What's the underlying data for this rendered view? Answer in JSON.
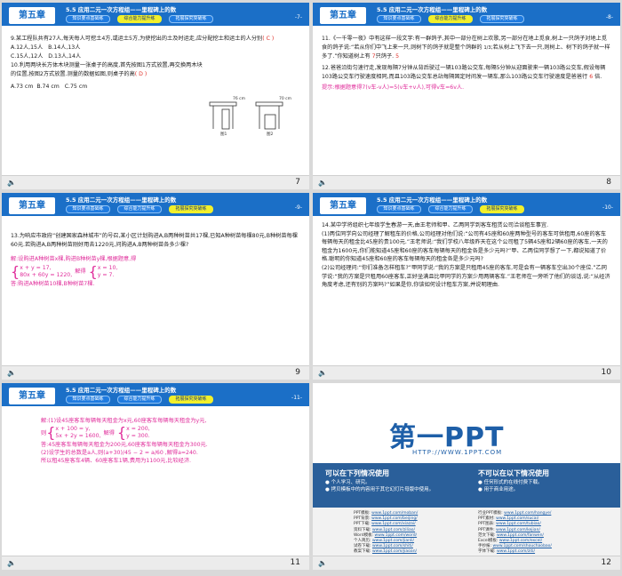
{
  "common": {
    "chapter": "第五章",
    "subtitle": "5.5 应用二元一次方程组——里程碑上的数",
    "tabs": [
      "知识要点基础练",
      "综合能力提升练",
      "拓展探究突破练"
    ]
  },
  "slides": [
    {
      "page_label": "-7-",
      "active_tab": 1,
      "footer_num": "7",
      "q9": "9.某工程队共有27人,每天每人可挖土4方,或运土5方,为使挖出的土及时运走,应分配挖土和运土的人分别",
      "q9_answer": "( C )",
      "q9_options": [
        "A.12人,15人",
        "B.14人,13人",
        "C.15人,12人",
        "D.13人,14人"
      ],
      "q10": "10.利用两块长方体木块测量一张桌子的高度,首先按图1方式放置,再交换两木块的位置,按图2方式放置.测量的数据如图,则桌子的高",
      "q10_answer": "( D )",
      "q10_options": [
        "A.73 cm",
        "B.74 cm",
        "C.75 cm"
      ],
      "fig_labels": [
        "图1",
        "图2",
        "76 cm",
        "70 cm"
      ]
    },
    {
      "page_label": "-8-",
      "active_tab": 1,
      "footer_num": "8",
      "q11": "11.《一千零一夜》中有这样一段文字:有一群鸽子,其中一部分在树上欢歌,另一部分在地上觅食,树上一只鸽子对地上觅食的鸽子说:“若从你们中飞上来一只,则树下的鸽子就是整个鸽群的",
      "q11_b": ";若从树上飞下去一只,则树上、树下的鸽子就一样多了.”你知道树上有",
      "q11_answer": "7",
      "q11_c": "只鸽子.",
      "q11_d": "5",
      "q12": "12.爸爸沿街匀速行走,发现每隔7分钟从背后驶过一辆103路公交车,每隔5分钟从迎面驶来一辆103路公交车,假设每辆103路公交车行驶速度相同,而且103路公交车总站每隔固定时间发一辆车,那么103路公交车行驶速度是爸爸行",
      "q12_answer": "6",
      "q12_b": "倍.",
      "hint": "提示:根据题意得7(v车-v人)=5(v车+v人),可得v车=6v人."
    },
    {
      "page_label": "-9-",
      "active_tab": 2,
      "footer_num": "9",
      "q13": "13.为响应市政府“创建国家森林城市”的号召,某小区计划购进A,B两种树苗共17棵,已知A种树苗每棵80元,B种树苗每棵60元.若购进A,B两种树苗刚好用去1220元,问购进A,B两种树苗各多少棵?",
      "sol_1": "解:设购进A种树苗x棵,购进B种树苗y棵,根据题意,得",
      "sol_eq1": "x + y = 17,",
      "sol_eq2": "80x + 60y = 1220,",
      "sol_solve": "解得",
      "sol_res1": "x = 10,",
      "sol_res2": "y = 7.",
      "sol_2": "答:购进A种树苗10棵,B种树苗7棵."
    },
    {
      "page_label": "-10-",
      "active_tab": 2,
      "footer_num": "10",
      "q14": "14.某中学将组织七年级学生春游一天,由王老师和甲、乙两同学到客车租赁公司洽谈租车事宜.",
      "q14_1": "(1)两位同学向公司经理了解租车的价格,公司经理对他们说:“公司有45座和60座两种型号的客车可供租用,60座的客车每辆每天的租金比45座的贵100元.”王老师说:“我们学校八年级昨天在这个公司租了5辆45座和2辆60座的客车,一天的租金为1600元,你们能知道45座和60座的客车每辆每天的租金各是多少元吗?”甲、乙两位同学想了一下,都说知道了价格.聪明的你知道45座和60座的客车每辆每天的租金各是多少元吗?",
      "q14_2": "(2)公司经理问:“你们准备怎样租车?”甲同学说:“我的方案是只租用45座的客车,可是会有一辆客车空出30个座位.”乙同学说:“我的方案是只租用60座客车,正好坐满且比甲同学的方案少用两辆客车.”王老师在一旁听了他们的谈话,说:“从经济角度考虑,还有别的方案吗?”如果是你,你该如何设计租车方案,并说明理由."
    },
    {
      "page_label": "-11-",
      "active_tab": 2,
      "footer_num": "11",
      "sol_1": "解:(1)设45座客车每辆每天租金为x元,60座客车每辆每天租金为y元,",
      "sol_then": "则",
      "sol_eq1": "x + 100 = y,",
      "sol_eq2": "5x + 2y = 1600,",
      "sol_solve": "解得",
      "sol_res1": "x = 200,",
      "sol_res2": "y = 300.",
      "sol_2": "答:45座客车每辆每天租金为200元,60座客车每辆每天租金为300元.",
      "sol_3": "(2)设学生的总数是a人,则",
      "sol_frac": "(a+30)/45 − 2 = a/60 ,解得a=240.",
      "sol_4": "所以租45座客车4辆、60座客车1辆,费用为1100元,比较经济."
    },
    {
      "footer_num": "12",
      "logo": "第一PPT",
      "logo_url": "HTTP://WWW.1PPT.COM",
      "allow_title": "可以在下列情况使用",
      "allow_items": [
        "个人学习、研究。",
        "拷贝模板中的内容用于其它幻灯片母版中使用。"
      ],
      "deny_title": "不可以在以下情况使用",
      "deny_items": [
        "任何形式的在线付费下载。",
        "用于商业用途。"
      ],
      "links_left": [
        {
          "k": "PPT模板:",
          "v": "www.1ppt.com/moban/"
        },
        {
          "k": "PPT背景:",
          "v": "www.1ppt.com/beijing/"
        },
        {
          "k": "PPT下载:",
          "v": "www.1ppt.com/xiazai/"
        },
        {
          "k": "资料下载:",
          "v": "www.1ppt.com/ziliao/"
        },
        {
          "k": "Word模板:",
          "v": "www.1ppt.com/word/"
        },
        {
          "k": "个人简历:",
          "v": "www.1ppt.com/jianli/"
        },
        {
          "k": "试卷下载:",
          "v": "www.1ppt.com/shiti/"
        },
        {
          "k": "教案下载:",
          "v": "www.1ppt.com/jiaoan/"
        }
      ],
      "links_right": [
        {
          "k": "行业PPT模板:",
          "v": "www.1ppt.com/hangye/"
        },
        {
          "k": "PPT素材:",
          "v": "www.1ppt.com/sucai/"
        },
        {
          "k": "PPT图表:",
          "v": "www.1ppt.com/tubiao/"
        },
        {
          "k": "PPT课件:",
          "v": "www.1ppt.com/kejian/"
        },
        {
          "k": "范文下载:",
          "v": "www.1ppt.com/fanwen/"
        },
        {
          "k": "Excel模板:",
          "v": "www.1ppt.com/excel/"
        },
        {
          "k": "手抄报:",
          "v": "www.1ppt.com/shouchaobao/"
        },
        {
          "k": "字体下载:",
          "v": "www.1ppt.com/ziti/"
        }
      ]
    }
  ]
}
